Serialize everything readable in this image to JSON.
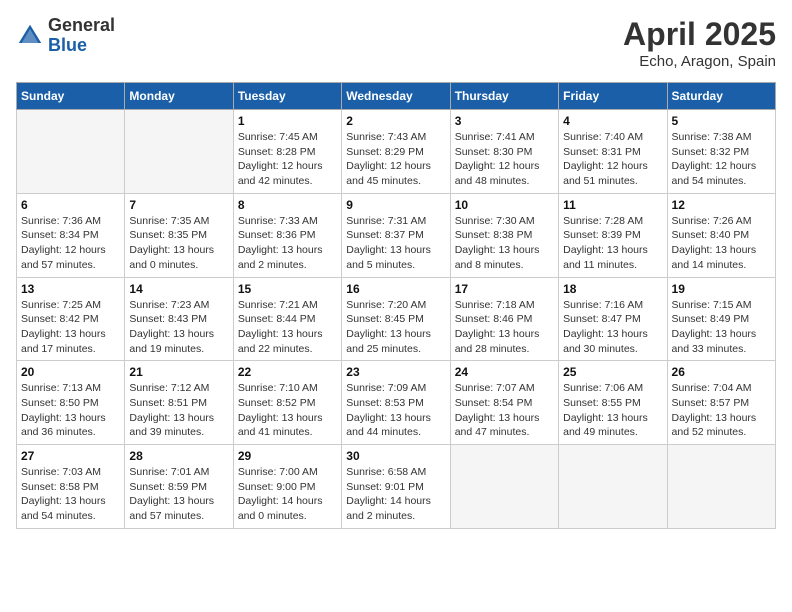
{
  "header": {
    "logo_general": "General",
    "logo_blue": "Blue",
    "month_title": "April 2025",
    "location": "Echo, Aragon, Spain"
  },
  "days_of_week": [
    "Sunday",
    "Monday",
    "Tuesday",
    "Wednesday",
    "Thursday",
    "Friday",
    "Saturday"
  ],
  "weeks": [
    [
      {
        "day": "",
        "empty": true
      },
      {
        "day": "",
        "empty": true
      },
      {
        "day": "1",
        "sunrise": "7:45 AM",
        "sunset": "8:28 PM",
        "daylight": "12 hours and 42 minutes."
      },
      {
        "day": "2",
        "sunrise": "7:43 AM",
        "sunset": "8:29 PM",
        "daylight": "12 hours and 45 minutes."
      },
      {
        "day": "3",
        "sunrise": "7:41 AM",
        "sunset": "8:30 PM",
        "daylight": "12 hours and 48 minutes."
      },
      {
        "day": "4",
        "sunrise": "7:40 AM",
        "sunset": "8:31 PM",
        "daylight": "12 hours and 51 minutes."
      },
      {
        "day": "5",
        "sunrise": "7:38 AM",
        "sunset": "8:32 PM",
        "daylight": "12 hours and 54 minutes."
      }
    ],
    [
      {
        "day": "6",
        "sunrise": "7:36 AM",
        "sunset": "8:34 PM",
        "daylight": "12 hours and 57 minutes."
      },
      {
        "day": "7",
        "sunrise": "7:35 AM",
        "sunset": "8:35 PM",
        "daylight": "13 hours and 0 minutes."
      },
      {
        "day": "8",
        "sunrise": "7:33 AM",
        "sunset": "8:36 PM",
        "daylight": "13 hours and 2 minutes."
      },
      {
        "day": "9",
        "sunrise": "7:31 AM",
        "sunset": "8:37 PM",
        "daylight": "13 hours and 5 minutes."
      },
      {
        "day": "10",
        "sunrise": "7:30 AM",
        "sunset": "8:38 PM",
        "daylight": "13 hours and 8 minutes."
      },
      {
        "day": "11",
        "sunrise": "7:28 AM",
        "sunset": "8:39 PM",
        "daylight": "13 hours and 11 minutes."
      },
      {
        "day": "12",
        "sunrise": "7:26 AM",
        "sunset": "8:40 PM",
        "daylight": "13 hours and 14 minutes."
      }
    ],
    [
      {
        "day": "13",
        "sunrise": "7:25 AM",
        "sunset": "8:42 PM",
        "daylight": "13 hours and 17 minutes."
      },
      {
        "day": "14",
        "sunrise": "7:23 AM",
        "sunset": "8:43 PM",
        "daylight": "13 hours and 19 minutes."
      },
      {
        "day": "15",
        "sunrise": "7:21 AM",
        "sunset": "8:44 PM",
        "daylight": "13 hours and 22 minutes."
      },
      {
        "day": "16",
        "sunrise": "7:20 AM",
        "sunset": "8:45 PM",
        "daylight": "13 hours and 25 minutes."
      },
      {
        "day": "17",
        "sunrise": "7:18 AM",
        "sunset": "8:46 PM",
        "daylight": "13 hours and 28 minutes."
      },
      {
        "day": "18",
        "sunrise": "7:16 AM",
        "sunset": "8:47 PM",
        "daylight": "13 hours and 30 minutes."
      },
      {
        "day": "19",
        "sunrise": "7:15 AM",
        "sunset": "8:49 PM",
        "daylight": "13 hours and 33 minutes."
      }
    ],
    [
      {
        "day": "20",
        "sunrise": "7:13 AM",
        "sunset": "8:50 PM",
        "daylight": "13 hours and 36 minutes."
      },
      {
        "day": "21",
        "sunrise": "7:12 AM",
        "sunset": "8:51 PM",
        "daylight": "13 hours and 39 minutes."
      },
      {
        "day": "22",
        "sunrise": "7:10 AM",
        "sunset": "8:52 PM",
        "daylight": "13 hours and 41 minutes."
      },
      {
        "day": "23",
        "sunrise": "7:09 AM",
        "sunset": "8:53 PM",
        "daylight": "13 hours and 44 minutes."
      },
      {
        "day": "24",
        "sunrise": "7:07 AM",
        "sunset": "8:54 PM",
        "daylight": "13 hours and 47 minutes."
      },
      {
        "day": "25",
        "sunrise": "7:06 AM",
        "sunset": "8:55 PM",
        "daylight": "13 hours and 49 minutes."
      },
      {
        "day": "26",
        "sunrise": "7:04 AM",
        "sunset": "8:57 PM",
        "daylight": "13 hours and 52 minutes."
      }
    ],
    [
      {
        "day": "27",
        "sunrise": "7:03 AM",
        "sunset": "8:58 PM",
        "daylight": "13 hours and 54 minutes."
      },
      {
        "day": "28",
        "sunrise": "7:01 AM",
        "sunset": "8:59 PM",
        "daylight": "13 hours and 57 minutes."
      },
      {
        "day": "29",
        "sunrise": "7:00 AM",
        "sunset": "9:00 PM",
        "daylight": "14 hours and 0 minutes."
      },
      {
        "day": "30",
        "sunrise": "6:58 AM",
        "sunset": "9:01 PM",
        "daylight": "14 hours and 2 minutes."
      },
      {
        "day": "",
        "empty": true
      },
      {
        "day": "",
        "empty": true
      },
      {
        "day": "",
        "empty": true
      }
    ]
  ],
  "labels": {
    "sunrise": "Sunrise: ",
    "sunset": "Sunset: ",
    "daylight": "Daylight: "
  }
}
